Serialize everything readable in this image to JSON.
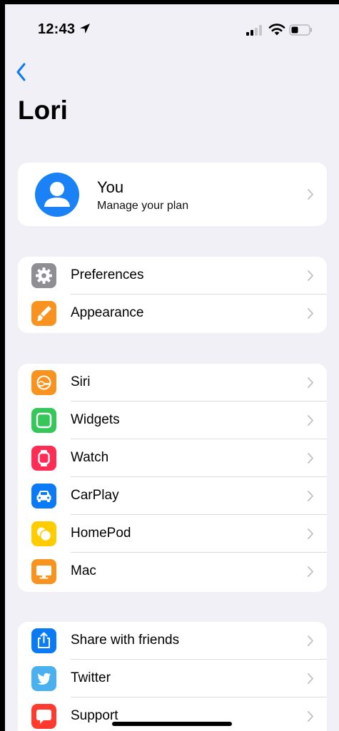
{
  "status_bar": {
    "time": "12:43",
    "icons": [
      "location-arrow-icon",
      "cellular-signal-icon",
      "wifi-icon",
      "battery-icon"
    ]
  },
  "nav": {
    "back_icon": "chevron-left-icon"
  },
  "page": {
    "title": "Lori"
  },
  "profile": {
    "name": "You",
    "subtitle": "Manage your plan",
    "avatar_icon": "person-icon",
    "avatar_color": "#1a82f6"
  },
  "groups": [
    {
      "items": [
        {
          "label": "Preferences",
          "icon": "gear-icon",
          "color": "#8e8e93"
        },
        {
          "label": "Appearance",
          "icon": "paintbrush-icon",
          "color": "#f7931e"
        }
      ]
    },
    {
      "items": [
        {
          "label": "Siri",
          "icon": "siri-icon",
          "color": "#f7931e"
        },
        {
          "label": "Widgets",
          "icon": "widget-square-icon",
          "color": "#35c759"
        },
        {
          "label": "Watch",
          "icon": "watch-icon",
          "color": "#ff2d55"
        },
        {
          "label": "CarPlay",
          "icon": "car-icon",
          "color": "#0a7af5"
        },
        {
          "label": "HomePod",
          "icon": "homepod-icon",
          "color": "#ffcc00"
        },
        {
          "label": "Mac",
          "icon": "desktop-icon",
          "color": "#f7931e"
        }
      ]
    },
    {
      "items": [
        {
          "label": "Share with friends",
          "icon": "share-icon",
          "color": "#0a7af5"
        },
        {
          "label": "Twitter",
          "icon": "twitter-bird-icon",
          "color": "#4ab0ee"
        },
        {
          "label": "Support",
          "icon": "chat-bubble-icon",
          "color": "#ff3b30"
        }
      ]
    }
  ]
}
